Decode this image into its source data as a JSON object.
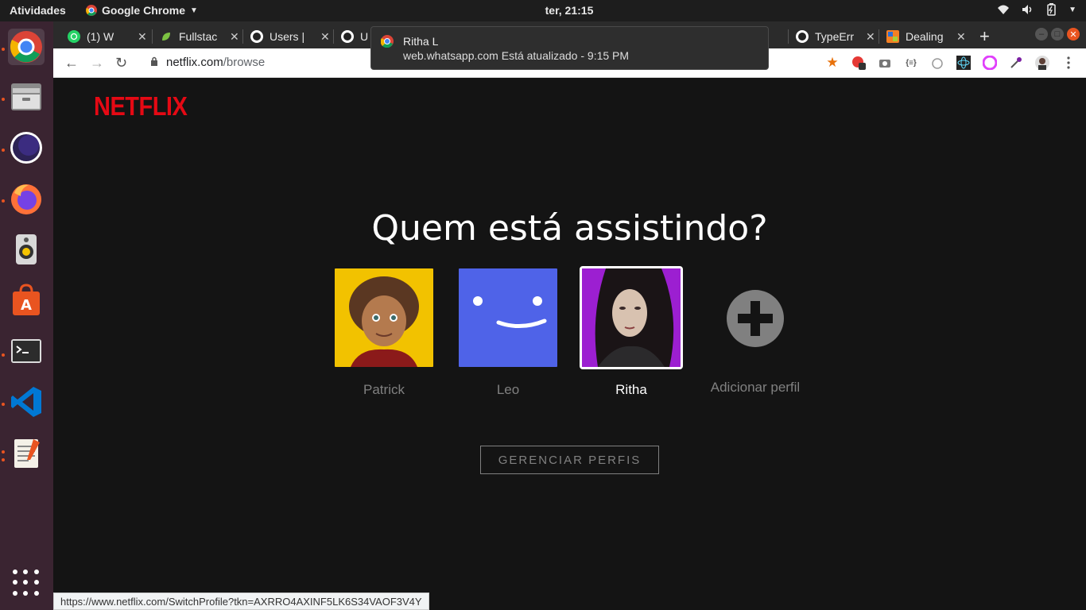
{
  "system": {
    "activities": "Atividades",
    "app_menu": "Google Chrome",
    "clock": "ter, 21:15"
  },
  "dock": {
    "apps": [
      "chrome-icon",
      "files-icon",
      "eclipse-icon",
      "firefox-icon",
      "rhythmbox-icon",
      "software-center-icon",
      "terminal-icon",
      "vscode-icon",
      "text-editor-icon",
      "show-apps-icon"
    ]
  },
  "tabs": [
    {
      "title": "(1) W",
      "icon": "whatsapp-icon"
    },
    {
      "title": "Fullstac",
      "icon": "leaf-icon"
    },
    {
      "title": "Users |",
      "icon": "github-icon"
    },
    {
      "title": "U",
      "icon": "github-icon"
    },
    {
      "title": "TypeErr",
      "icon": "github-icon"
    },
    {
      "title": "Dealing",
      "icon": "stack-icon"
    }
  ],
  "toolbar": {
    "url_domain": "netflix.com",
    "url_path": "/browse"
  },
  "notification": {
    "title": "Ritha L",
    "body": "web.whatsapp.com  Está atualizado - 9:15 PM"
  },
  "netflix": {
    "logo": "NETFLIX",
    "heading": "Quem está assistindo?",
    "profiles": [
      {
        "name": "Patrick",
        "selected": false
      },
      {
        "name": "Leo",
        "selected": false
      },
      {
        "name": "Ritha",
        "selected": true
      }
    ],
    "add_profile": "Adicionar perfil",
    "manage_button": "GERENCIAR PERFIS"
  },
  "status_url": "https://www.netflix.com/SwitchProfile?tkn=AXRRO4AXINF5LK6S34VAOF3V4Y",
  "colors": {
    "netflix_red": "#e50914",
    "background": "#141414",
    "leo_avatar": "#4f63e8",
    "dock_bg": "#3a2431"
  }
}
